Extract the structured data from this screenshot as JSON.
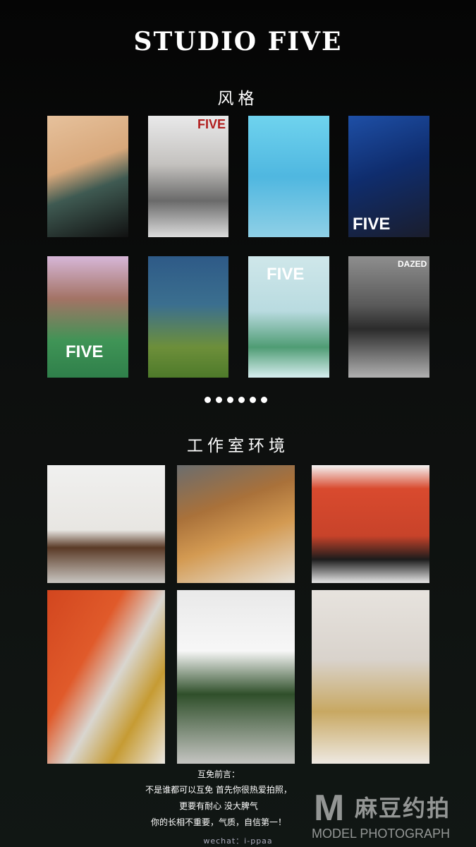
{
  "header": {
    "title": "STUDIO FIVE"
  },
  "style_section": {
    "title": "风格",
    "photos": [
      {
        "label": "",
        "bg": "linear-gradient(160deg,#e6c19c 0%,#d8a87b 40%,#3f5a52 60%,#111 100%)"
      },
      {
        "label": "FIVE",
        "bg": "linear-gradient(180deg,#e9e9ea 0%,#c4c2bf 40%,#6a6a6a 70%,#dcdcdc 100%)"
      },
      {
        "label": "",
        "bg": "linear-gradient(180deg,#6fd3ee 0%,#4fb7e0 50%,#8fd0e6 100%)"
      },
      {
        "label": "FIVE",
        "bg": "linear-gradient(160deg,#1e4fa6 0%,#0f2d6e 45%,#1a1d2c 100%)"
      },
      {
        "label": "FIVE",
        "bg": "linear-gradient(180deg,#d7b7d8 0%,#a37365 35%,#3f9456 70%,#2f7f4a 100%)"
      },
      {
        "label": "",
        "bg": "linear-gradient(180deg,#2e5a87 0%,#3b6f8f 40%,#6d8f3a 75%,#4e7a2a 100%)"
      },
      {
        "label": "FIVE",
        "bg": "linear-gradient(180deg,#cfe7ea 0%,#b9dbe0 45%,#4f9c74 75%,#d7eef0 100%)"
      },
      {
        "label": "DAZED",
        "bg": "linear-gradient(180deg,#8e8e8e 0%,#5a5a5a 40%,#2b2b2b 60%,#b1b1b1 100%)"
      }
    ]
  },
  "pagination": {
    "count": 6
  },
  "studio_section": {
    "title": "工作室环境",
    "photos": [
      {
        "bg": "linear-gradient(180deg,#f0f0ef 0%,#e8e6e2 55%,#5a3a26 70%,#c9c6c1 100%)"
      },
      {
        "bg": "linear-gradient(160deg,#6b6d6e 0%,#a9713a 35%,#d39a52 60%,#e7e2d9 100%)"
      },
      {
        "bg": "linear-gradient(180deg,#f4f4f4 0%,#d94a2e 20%,#c8432a 60%,#1c1c1c 80%,#e7e7e7 100%)"
      },
      {
        "bg": "linear-gradient(120deg,#d2461f 0%,#e05a2a 35%,#d9d6d0 55%,#c69b33 75%,#eae7e2 100%)"
      },
      {
        "bg": "linear-gradient(180deg,#e9e9e9 0%,#f7f7f7 35%,#2f4f2a 60%,#c5c5c2 100%)"
      },
      {
        "bg": "linear-gradient(180deg,#e7e3de 0%,#d9d3cc 40%,#c8a862 70%,#eee9e2 100%)"
      }
    ]
  },
  "notes": {
    "heading": "互免前言：",
    "line1": "不是谁都可以互免 首先你很热爱拍照，",
    "line2": "更要有耐心 没大脾气",
    "line3": "你的长相不重要，气质，自信第一！",
    "wechat": "wechat：i-ppaa"
  },
  "watermark": {
    "mark": "M",
    "cn": "麻豆约拍",
    "en": "MODEL PHOTOGRAPH"
  }
}
